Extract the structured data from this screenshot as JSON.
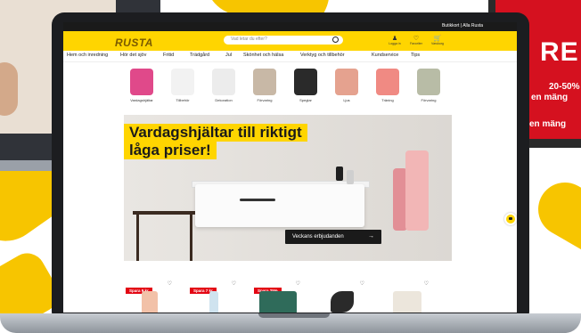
{
  "site": {
    "logo_text": "RUSTA",
    "store_text": "Butikkort | Alla Rusta",
    "search_placeholder": "Vad letar du efter?",
    "header_icons": [
      {
        "icon": "user-icon",
        "label": "Logga in"
      },
      {
        "icon": "heart-icon",
        "label": "Favoriter"
      },
      {
        "icon": "cart-icon",
        "label": "Varukorg"
      }
    ]
  },
  "nav": [
    "Hem och inredning",
    "Hör det sjöv",
    "Fritid",
    "Trädgård",
    "Jul",
    "Skönhet och hälsa",
    "Verktyg och tillbehör",
    "Kundservice",
    "Tips"
  ],
  "categories": [
    {
      "label": "Vardagshjältar",
      "color": "#e0498a"
    },
    {
      "label": "Tillbehör",
      "color": "#f2f2f2"
    },
    {
      "label": "Dekoration",
      "color": "#ececec"
    },
    {
      "label": "Förvaring",
      "color": "#c8b8a6"
    },
    {
      "label": "Speglar",
      "color": "#2a2a2a"
    },
    {
      "label": "Ljus",
      "color": "#e5a28f"
    },
    {
      "label": "Träning",
      "color": "#f08a83"
    },
    {
      "label": "Förvaring",
      "color": "#b8bca6"
    }
  ],
  "hero": {
    "headline_line1": "Vardagshjältar till riktigt",
    "headline_line2": "låga priser!",
    "cta_label": "Veckans erbjudanden"
  },
  "products": [
    {
      "badge": "Spara 9 kr",
      "color": "#f2c1a8"
    },
    {
      "badge": "Spara 7 kr",
      "color": "#cfe3ef"
    },
    {
      "badge": "Spara 25%",
      "color": "#2f6b5a"
    },
    {
      "badge": "",
      "color": "#2a2a2a"
    },
    {
      "badge": "",
      "color": "#ece6dc"
    }
  ],
  "promo": {
    "big_text": "RE",
    "line1": "20-50%",
    "line2": "en mäng",
    "line3": "en mäng"
  }
}
